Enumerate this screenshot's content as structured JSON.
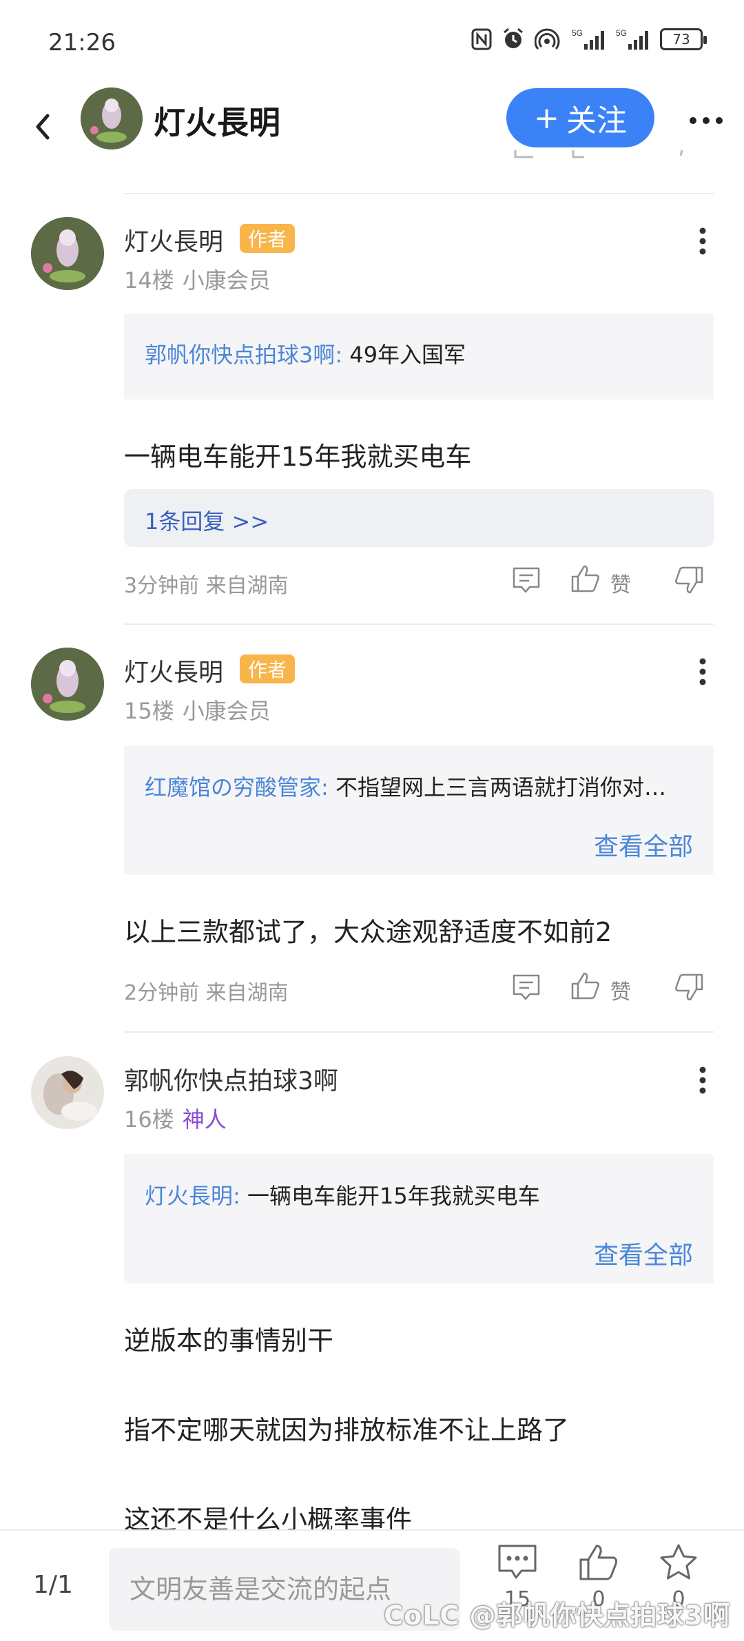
{
  "status_bar": {
    "time": "21:26",
    "battery": "73",
    "signal_1": "5G",
    "signal_2": "5G"
  },
  "header": {
    "title": "灯火長明",
    "follow_label": "关注",
    "follow_prefix": "+"
  },
  "posts": [
    {
      "username": "灯火長明",
      "badge": "作者",
      "floor": "14楼",
      "level": "小康会员",
      "quote_author": "郭帆你快点拍球3啊:",
      "quote_text": "49年入国军",
      "content": [
        "一辆电车能开15年我就买电车"
      ],
      "reply_link": "1条回复 >>",
      "meta": "3分钟前 来自湖南",
      "like_label": "赞"
    },
    {
      "username": "灯火長明",
      "badge": "作者",
      "floor": "15楼",
      "level": "小康会员",
      "quote_author": "红魔馆の穷酸管家:",
      "quote_text": "不指望网上三言两语就打消你对…",
      "view_all": "查看全部",
      "content": [
        "以上三款都试了，大众途观舒适度不如前2"
      ],
      "meta": "2分钟前 来自湖南",
      "like_label": "赞"
    },
    {
      "username": "郭帆你快点拍球3啊",
      "floor": "16楼",
      "level": "神人",
      "quote_author": "灯火長明:",
      "quote_text": "一辆电车能开15年我就买电车",
      "view_all": "查看全部",
      "content": [
        "逆版本的事情别干",
        "指不定哪天就因为排放标准不让上路了",
        "这还不是什么小概率事件"
      ]
    }
  ],
  "bottom_bar": {
    "page": "1/1",
    "input_placeholder": "文明友善是交流的起点",
    "comment_count": "15",
    "like_count": "0",
    "favorite_count": "0",
    "watermark": "@郭帆你快点拍球3啊",
    "watermark_logo": "CoLC"
  },
  "colors": {
    "accent": "#3b82f6",
    "badge": "#f7b54a",
    "link": "#4a86d8",
    "level_purple": "#8a4bd6"
  }
}
